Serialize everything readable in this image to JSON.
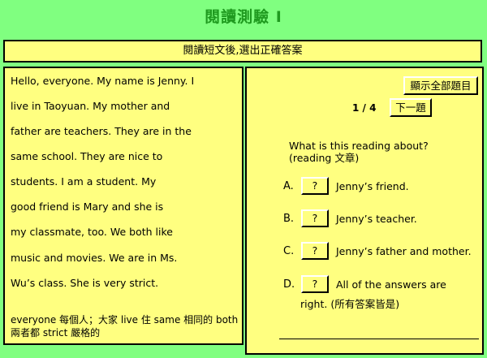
{
  "title": "閱讀測驗 I",
  "instruction": "閱讀短文後,選出正確答案",
  "passage": {
    "lines": [
      "Hello, everyone. My name is Jenny. I",
      "live in Taoyuan. My mother and",
      "father are teachers. They are in the",
      "same school. They are nice to",
      "students. I am a student. My",
      "good friend is Mary and she is",
      "my classmate, too. We both like",
      "music and movies. We are in Ms.",
      "Wu’s class. She is very strict."
    ],
    "vocab": "everyone 每個人；大家 live 住 same 相同的 both 兩者都 strict 嚴格的"
  },
  "controls": {
    "show_all_label": "顯示全部題目",
    "counter": "1 / 4",
    "next_label": "下一題"
  },
  "question": {
    "text_line1": "What is this reading about?",
    "text_line2": "(reading 文章)",
    "options": [
      {
        "letter": "A.",
        "button": "?",
        "text": "Jenny’s friend.",
        "continuation": ""
      },
      {
        "letter": "B.",
        "button": "?",
        "text": "Jenny’s teacher.",
        "continuation": ""
      },
      {
        "letter": "C.",
        "button": "?",
        "text": "Jenny’s father and mother.",
        "continuation": ""
      },
      {
        "letter": "D.",
        "button": "?",
        "text": "All of the answers are",
        "continuation": "right. (所有答案皆是)"
      }
    ]
  }
}
